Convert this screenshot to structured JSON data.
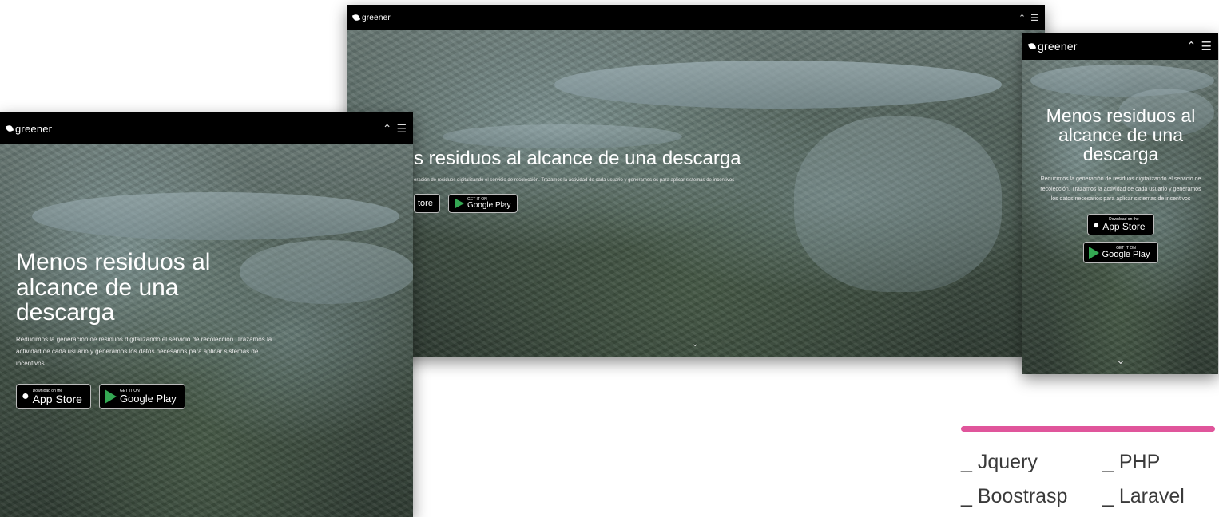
{
  "brand": {
    "logo_text": "greener"
  },
  "hero": {
    "headline": "Menos residuos al alcance de una descarga",
    "headline_cropped": "s residuos al alcance de una descarga",
    "description": "Reducimos la generación de residuos digitalizando el servicio de recolección. Trazamos la actividad de cada usuario y generamos los datos necesarios para aplicar sistemas de incentivos",
    "description_cropped": "eración de residuos digitalizando el servicio de recolección. Trazamos la actividad de cada usuario y generamos os para aplicar sistemas de incentivos"
  },
  "badges": {
    "appstore_small": "Download on the",
    "appstore_label": "App Store",
    "appstore_cropped": "tore",
    "googleplay_small": "GET IT ON",
    "googleplay_label": "Google Play"
  },
  "icons": {
    "collapse": "chevron-up-icon",
    "menu": "hamburger-icon",
    "scroll": "chevron-down-icon"
  },
  "tech_stack": {
    "items": [
      "_ Jquery",
      "_ PHP",
      "_ Boostrasp",
      "_ Laravel"
    ]
  },
  "colors": {
    "accent": "#e0559b",
    "topbar": "#000000"
  }
}
